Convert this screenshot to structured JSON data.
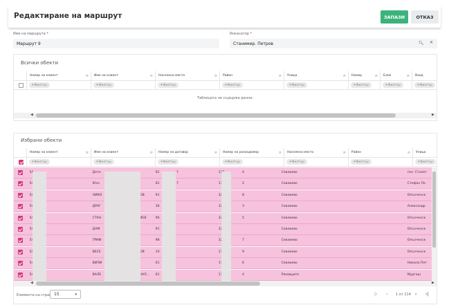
{
  "header": {
    "title": "Редактиране на маршрут",
    "save_label": "ЗАПАЗИ",
    "cancel_label": "ОТКАЗ"
  },
  "route_name": {
    "label": "Име на маршрута",
    "value": "Маршрут 9"
  },
  "collector": {
    "label": "Инкасатор",
    "value": "Станимир. Петров"
  },
  "all_objects": {
    "title": "Всички обекти",
    "columns": [
      "Номер на клиент",
      "Име на клиент",
      "Населено място",
      "Район",
      "Улица",
      "Номер",
      "Блок",
      "Вход"
    ],
    "filter_label": "Филтър",
    "empty_text": "Таблицата не съдържа данни."
  },
  "selected_objects": {
    "title": "Избрани обекти",
    "columns": [
      "Номер на клиент",
      "Име на клиент",
      "Номер на договор",
      "Номер на разходомер",
      "Населено място",
      "Район",
      "Улица"
    ],
    "filter_label": "Филтър",
    "rows": [
      {
        "client_no": "54",
        "name": "Дете",
        "contract": "62",
        "meter": "132",
        "place": "Севлиево",
        "street": "ген. Столет"
      },
      {
        "client_no": "54",
        "name": "Юсе",
        "contract": "62",
        "meter": "132",
        "place": "Севлиево",
        "street": "Стефан Пе"
      },
      {
        "client_no": "54",
        "name": "НИКО",
        "contract": "91",
        "meter": "322",
        "place": "Севлиево",
        "street": "Опълченск"
      },
      {
        "client_no": "54",
        "name": "ДРАГ",
        "contract": "36",
        "meter": "322",
        "place": "Севлиево",
        "street": "Александр"
      },
      {
        "client_no": "54",
        "name": "СТАН",
        "contract": "96",
        "meter": "322",
        "place": "Севлиево",
        "street": "Опълченск"
      },
      {
        "client_no": "54",
        "name": "ДАМ",
        "contract": "91",
        "meter": "322",
        "place": "Севлиево",
        "street": "Опълченск"
      },
      {
        "client_no": "54",
        "name": "ТРИФ",
        "contract": "98",
        "meter": "322",
        "place": "Севлиево",
        "street": "Опълченск"
      },
      {
        "client_no": "54",
        "name": "ВЕСЕ",
        "contract": "10",
        "meter": "111",
        "place": "Севлиево",
        "street": "Опълченск"
      },
      {
        "client_no": "54",
        "name": "ВИЛИ",
        "contract": "61",
        "meter": "111",
        "place": "Севлиево",
        "street": "Никола Пет"
      },
      {
        "client_no": "54",
        "name": "ВАЛЕ",
        "contract": "61",
        "meter": "111",
        "place": "Ряховците",
        "street": "Мургаш"
      }
    ],
    "name_suffixes": [
      "",
      "",
      "ОВ",
      "",
      "ИЕВ",
      "",
      "",
      "ОВ",
      "",
      "ЧАЛ..."
    ],
    "meter_suffixes": [
      "4",
      "2",
      "8",
      "3",
      "5",
      "",
      "7",
      "9",
      "6",
      "4"
    ],
    "contract_suffixes": [
      "7",
      "7",
      "",
      "",
      "",
      "",
      "",
      "",
      "",
      ""
    ]
  },
  "pager": {
    "label": "Елементи на страница",
    "page_size": "15",
    "range": "1 от 114"
  }
}
